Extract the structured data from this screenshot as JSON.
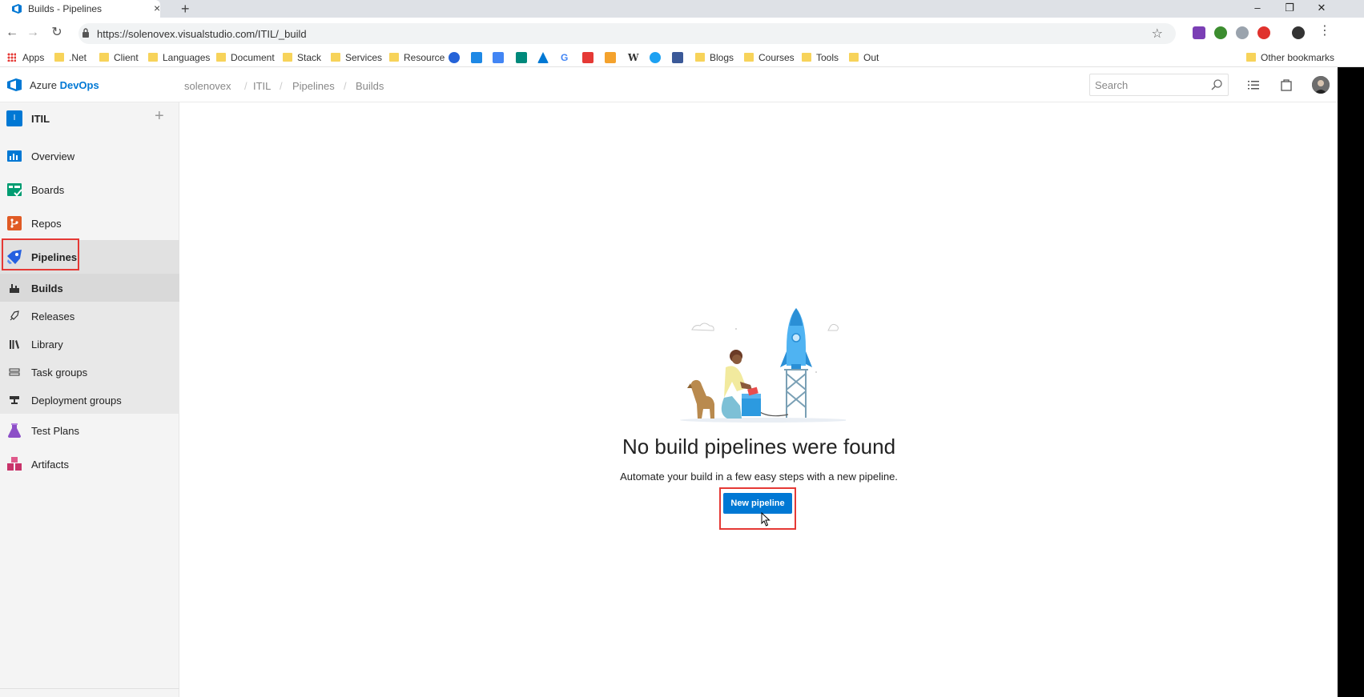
{
  "browser": {
    "tab_title": "Builds - Pipelines",
    "url": "https://solenovex.visualstudio.com/ITIL/_build",
    "bookmarks": [
      {
        "label": "Apps",
        "type": "apps"
      },
      {
        "label": ".Net",
        "type": "folder"
      },
      {
        "label": "Client",
        "type": "folder"
      },
      {
        "label": "Languages",
        "type": "folder"
      },
      {
        "label": "Document",
        "type": "folder"
      },
      {
        "label": "Stack",
        "type": "folder"
      },
      {
        "label": "Services",
        "type": "folder"
      },
      {
        "label": "Resource",
        "type": "folder"
      },
      {
        "label": "Blogs",
        "type": "folder"
      },
      {
        "label": "Courses",
        "type": "folder"
      },
      {
        "label": "Tools",
        "type": "folder"
      },
      {
        "label": "Out",
        "type": "folder"
      }
    ],
    "other_bookmarks": "Other bookmarks"
  },
  "header": {
    "brand_prefix": "Azure ",
    "brand_suffix": "DevOps",
    "breadcrumb": [
      "solenovex",
      "ITIL",
      "Pipelines",
      "Builds"
    ],
    "search_placeholder": "Search"
  },
  "sidebar": {
    "project_initial": "I",
    "project_name": "ITIL",
    "items": [
      {
        "label": "Overview",
        "icon": "overview-icon",
        "color": "#0078d4"
      },
      {
        "label": "Boards",
        "icon": "boards-icon",
        "color": "#009c71"
      },
      {
        "label": "Repos",
        "icon": "repos-icon",
        "color": "#e05a24"
      },
      {
        "label": "Pipelines",
        "icon": "pipelines-icon",
        "color": "#2560e0"
      }
    ],
    "sub_items": [
      {
        "label": "Builds",
        "icon": "builds-icon"
      },
      {
        "label": "Releases",
        "icon": "releases-icon"
      },
      {
        "label": "Library",
        "icon": "library-icon"
      },
      {
        "label": "Task groups",
        "icon": "task-groups-icon"
      },
      {
        "label": "Deployment groups",
        "icon": "deployment-groups-icon"
      }
    ],
    "bottom_items": [
      {
        "label": "Test Plans",
        "icon": "test-plans-icon",
        "color": "#8c4fc7"
      },
      {
        "label": "Artifacts",
        "icon": "artifacts-icon",
        "color": "#c8336a"
      }
    ]
  },
  "main": {
    "empty_title": "No build pipelines were found",
    "empty_subtitle": "Automate your build in a few easy steps with a new pipeline.",
    "new_pipeline_label": "New pipeline"
  },
  "colors": {
    "accent": "#0078d4",
    "highlight": "#e53935"
  }
}
